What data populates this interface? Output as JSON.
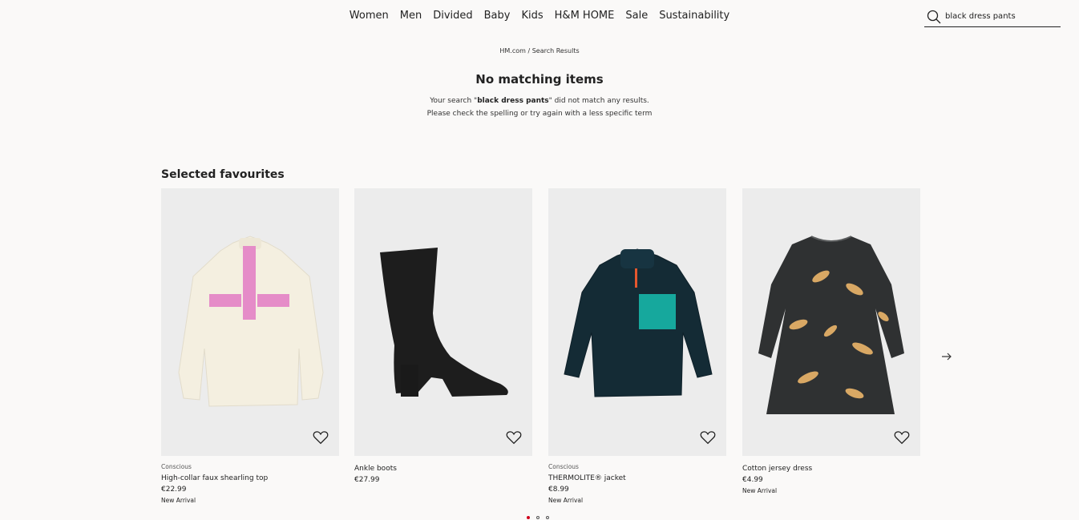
{
  "nav": {
    "items": [
      "Women",
      "Men",
      "Divided",
      "Baby",
      "Kids",
      "H&M HOME",
      "Sale",
      "Sustainability"
    ]
  },
  "search": {
    "value": "black dress pants",
    "icon": "search-icon"
  },
  "breadcrumb": "HM.com / Search Results",
  "no_results": {
    "title": "No matching items",
    "line1_prefix": "Your search \"",
    "query": "black dress pants",
    "line1_suffix": "\" did not match any results.",
    "line2": "Please check the spelling or try again with a less specific term"
  },
  "favourites": {
    "title": "Selected favourites",
    "products": [
      {
        "tag": "Conscious",
        "name": "High-collar faux shearling top",
        "price": "€22.99",
        "marker": "New Arrival",
        "image": "cream-fleece-pink-trim"
      },
      {
        "tag": "",
        "name": "Ankle boots",
        "price": "€27.99",
        "marker": "",
        "image": "black-suede-ankle-boot"
      },
      {
        "tag": "Conscious",
        "name": "THERMOLITE® jacket",
        "price": "€8.99",
        "marker": "New Arrival",
        "image": "navy-teddy-jacket-teal-pocket"
      },
      {
        "tag": "",
        "name": "Cotton jersey dress",
        "price": "€4.99",
        "marker": "New Arrival",
        "image": "dark-giraffe-print-dress"
      }
    ],
    "next_icon": "arrow-right-icon",
    "pagination_dots": 3,
    "active_dot": 1
  },
  "colors": {
    "background": "#faf9f8",
    "text": "#222222",
    "active_dot": "#d0011b"
  }
}
